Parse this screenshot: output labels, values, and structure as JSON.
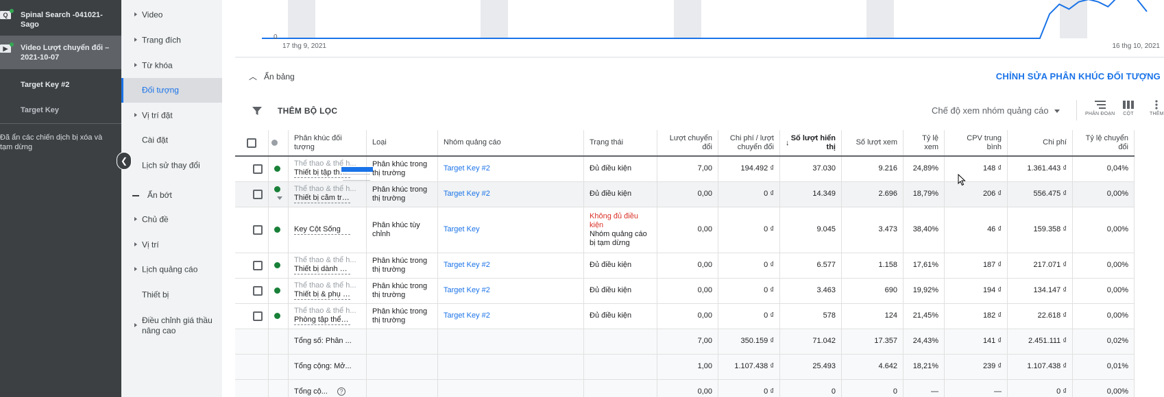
{
  "campaigns": {
    "items": [
      {
        "label": "Spinal Search -041021-Sago",
        "icon": "search-campaign-icon"
      },
      {
        "label": "Video Lượt chuyển đổi – 2021-10-07",
        "icon": "video-campaign-icon"
      },
      {
        "label": "Target Key #2"
      },
      {
        "label": "Target Key"
      }
    ],
    "hidden_note": "Đã ẩn các chiến dịch bị xóa và tạm dừng"
  },
  "pagenav": {
    "items": [
      {
        "label": "Video"
      },
      {
        "label": "Trang đích"
      },
      {
        "label": "Từ khóa"
      },
      {
        "label": "Đối tượng"
      },
      {
        "label": "Vị trí đặt"
      },
      {
        "label": "Cài đặt"
      },
      {
        "label": "Lịch sử thay đổi"
      }
    ],
    "group_label": "Ẩn bớt",
    "more": [
      {
        "label": "Chủ đề"
      },
      {
        "label": "Vị trí"
      },
      {
        "label": "Lịch quảng cáo"
      },
      {
        "label": "Thiết bị"
      },
      {
        "label": "Điều chỉnh giá thầu nâng cao"
      }
    ]
  },
  "chart": {
    "y_zero_label": "0",
    "x_start_label": "17 thg 9, 2021",
    "x_end_label": "16 thg 10, 2021",
    "line_color": "#1a73e8",
    "values": [
      0,
      0,
      0,
      0,
      0,
      0,
      0,
      0,
      0,
      0,
      0,
      0,
      0,
      0,
      0,
      0,
      0,
      0,
      0,
      0,
      0,
      0,
      0,
      0,
      0,
      0,
      0,
      0,
      0,
      0,
      0,
      0,
      0,
      0,
      0,
      0,
      0,
      0,
      0,
      0,
      0,
      0,
      0,
      0,
      0,
      0,
      0,
      0,
      0,
      0,
      0,
      0,
      0,
      0,
      0,
      0,
      0,
      0,
      0,
      0,
      0,
      0,
      0,
      0,
      0,
      0,
      0,
      0,
      0,
      0,
      0,
      0,
      0,
      0,
      0,
      0,
      0,
      0,
      0,
      0,
      0,
      1.0,
      1.4,
      1.2,
      1.5,
      1.6,
      1.5,
      1.3,
      1.7,
      1.8,
      1.6,
      1.1
    ]
  },
  "toolbar": {
    "table_toggle": "Ẩn bảng",
    "edit_segments": "CHỈNH SỬA PHÂN KHÚC ĐỐI TƯỢNG",
    "add_filter": "THÊM BỘ LỌC",
    "view_mode": "Chế độ xem nhóm quảng cáo",
    "segment_label": "PHÂN ĐOẠN",
    "columns_label": "CỘT",
    "more_label": "THÊM"
  },
  "table": {
    "headers": {
      "segment": "Phân khúc đối tượng",
      "type": "Loại",
      "adgroup": "Nhóm quảng cáo",
      "status": "Trạng thái",
      "conversions": "Lượt chuyển đổi",
      "cost_per_conv": "Chi phí / lượt chuyển đổi",
      "impressions": "Số lượt hiển thị",
      "views": "Số lượt xem",
      "view_rate": "Tỷ lệ xem",
      "avg_cpv": "CPV trung bình",
      "cost": "Chi phí",
      "conv_rate": "Tỷ lệ chuyển đổi"
    },
    "rows": [
      {
        "segment_parent": "Thể thao & thể h...",
        "segment": "Thiết bị tập thể ...",
        "type": "Phân khúc trong thị trường",
        "adgroup": "Target Key #2",
        "status": "Đủ điều kiện",
        "status_extra": "",
        "conversions": "7,00",
        "cost_per_conv": "194.492 ₫",
        "impressions": "37.030",
        "views": "9.216",
        "view_rate": "24,89%",
        "avg_cpv": "148 ₫",
        "cost": "1.361.443 ₫",
        "conv_rate": "0,04%"
      },
      {
        "segment_parent": "Thể thao & thể h...",
        "segment": "Thiết bị cắm trại...",
        "type": "Phân khúc trong thị trường",
        "adgroup": "Target Key #2",
        "status": "Đủ điều kiện",
        "status_extra": "",
        "conversions": "0,00",
        "cost_per_conv": "0 ₫",
        "impressions": "14.349",
        "views": "2.696",
        "view_rate": "18,79%",
        "avg_cpv": "206 ₫",
        "cost": "556.475 ₫",
        "conv_rate": "0,00%"
      },
      {
        "segment_parent": "",
        "segment": "Key Cột Sống",
        "type": "Phân khúc tùy chỉnh",
        "adgroup": "Target Key",
        "status": "Không đủ điều kiện",
        "status_extra": "Nhóm quảng cáo bị tạm dừng",
        "conversions": "0,00",
        "cost_per_conv": "0 ₫",
        "impressions": "9.045",
        "views": "3.473",
        "view_rate": "38,40%",
        "avg_cpv": "46 ₫",
        "cost": "159.358 ₫",
        "conv_rate": "0,00%"
      },
      {
        "segment_parent": "Thể thao & thể h...",
        "segment": "Thiết bị dành ch...",
        "type": "Phân khúc trong thị trường",
        "adgroup": "Target Key #2",
        "status": "Đủ điều kiện",
        "status_extra": "",
        "conversions": "0,00",
        "cost_per_conv": "0 ₫",
        "impressions": "6.577",
        "views": "1.158",
        "view_rate": "17,61%",
        "avg_cpv": "187 ₫",
        "cost": "217.071 ₫",
        "conv_rate": "0,00%"
      },
      {
        "segment_parent": "Thể thao & thể h...",
        "segment": "Thiết bị & phụ ki...",
        "type": "Phân khúc trong thị trường",
        "adgroup": "Target Key #2",
        "status": "Đủ điều kiện",
        "status_extra": "",
        "conversions": "0,00",
        "cost_per_conv": "0 ₫",
        "impressions": "3.463",
        "views": "690",
        "view_rate": "19,92%",
        "avg_cpv": "194 ₫",
        "cost": "134.147 ₫",
        "conv_rate": "0,00%"
      },
      {
        "segment_parent": "Thể thao & thể h...",
        "segment": "Phòng tập thể d...",
        "type": "Phân khúc trong thị trường",
        "adgroup": "Target Key #2",
        "status": "Đủ điều kiện",
        "status_extra": "",
        "conversions": "0,00",
        "cost_per_conv": "0 ₫",
        "impressions": "578",
        "views": "124",
        "view_rate": "21,45%",
        "avg_cpv": "182 ₫",
        "cost": "22.618 ₫",
        "conv_rate": "0,00%"
      }
    ],
    "totals": [
      {
        "label": "Tổng số: Phân ...",
        "conversions": "7,00",
        "cost_per_conv": "350.159 ₫",
        "impressions": "71.042",
        "views": "17.357",
        "view_rate": "24,43%",
        "avg_cpv": "141 ₫",
        "cost": "2.451.111 ₫",
        "conv_rate": "0,02%"
      },
      {
        "label": "Tổng cộng: Mở...",
        "conversions": "1,00",
        "cost_per_conv": "1.107.438 ₫",
        "impressions": "25.493",
        "views": "4.642",
        "view_rate": "18,21%",
        "avg_cpv": "239 ₫",
        "cost": "1.107.438 ₫",
        "conv_rate": "0,01%"
      },
      {
        "label": "Tổng cộ...",
        "conversions": "0,00",
        "cost_per_conv": "0 ₫",
        "impressions": "0",
        "views": "0",
        "view_rate": "—",
        "avg_cpv": "—",
        "cost": "0 ₫",
        "conv_rate": "0,00%"
      }
    ]
  },
  "colors": {
    "accent": "#1a73e8",
    "status_ok": "#188038",
    "status_bad": "#d93025"
  }
}
